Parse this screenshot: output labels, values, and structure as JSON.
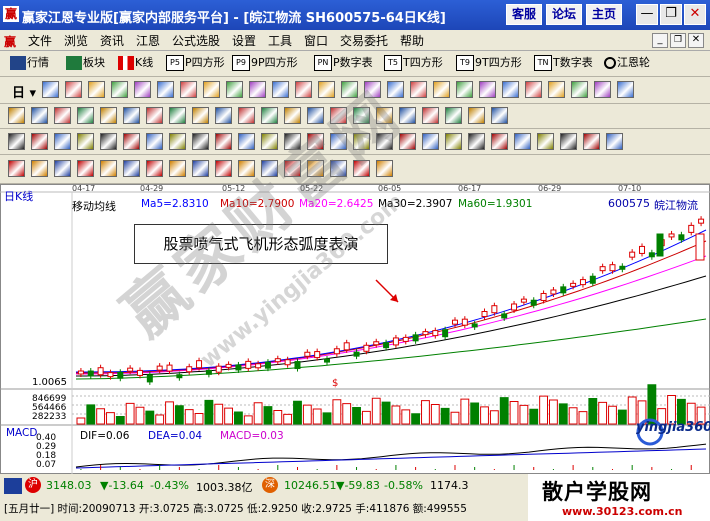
{
  "window": {
    "app_icon": "赢",
    "title": "赢家江恩专业版[赢家内部服务平台] - [皖江物流   SH600575-64日K线]",
    "buttons": [
      "客服",
      "论坛",
      "主页"
    ]
  },
  "menu": [
    "文件",
    "浏览",
    "资讯",
    "江恩",
    "公式选股",
    "设置",
    "工具",
    "窗口",
    "交易委托",
    "帮助"
  ],
  "toolbar1": [
    "行情",
    "板块",
    "K线",
    "P四方形",
    "9P四方形",
    "P数字表",
    "T四方形",
    "9T四方形",
    "T数字表",
    "江恩轮"
  ],
  "toolbar2_period": "日",
  "chart": {
    "period_label": "日K线",
    "date_ticks": [
      "04-17",
      "04-29",
      "05-12",
      "05-22",
      "06-05",
      "06-17",
      "06-29",
      "07-10"
    ],
    "ma_title": "移动均线",
    "ma": [
      {
        "label": "Ma5=2.8310",
        "color": "#0000ff"
      },
      {
        "label": "Ma10=2.7900",
        "color": "#cc0000"
      },
      {
        "label": "Ma20=2.6425",
        "color": "#ff00ff"
      },
      {
        "label": "Ma30=2.3907",
        "color": "#000000"
      },
      {
        "label": "Ma60=1.9301",
        "color": "#008000"
      }
    ],
    "stock_code": "600575",
    "stock_name": "皖江物流",
    "annotation": "股票喷气式飞机形态弧度表演",
    "price_low_label": "1.0065",
    "volume_labels": [
      "846699",
      "564466",
      "282233"
    ],
    "macd_title": "MACD",
    "dif": "DIF=0.06",
    "dea": "DEA=0.04",
    "macd": "MACD=0.03",
    "macd_ticks": [
      "0.40",
      "0.29",
      "0.18",
      "0.07"
    ],
    "watermark_text": "赢家财富网",
    "watermark_url": "www.yingjia360.com",
    "logo_text": "yingjia360",
    "chart_data": {
      "type": "candlestick",
      "ma_values": {
        "Ma5": 2.831,
        "Ma10": 2.79,
        "Ma20": 2.6425,
        "Ma30": 2.3907,
        "Ma60": 1.9301
      },
      "dates": [
        "04-17",
        "04-29",
        "05-12",
        "05-22",
        "06-05",
        "06-17",
        "06-29",
        "07-10"
      ],
      "last_close": 2.9725
    }
  },
  "status": {
    "sh_index": "3148.03",
    "sh_change": "▼-13.64",
    "sh_pct": "-0.43%",
    "sh_amount": "1003.38亿",
    "sz_index": "10246.51",
    "sz_change": "▼-59.83",
    "sz_pct": "-0.58%",
    "sz_amount": "1174.3",
    "row2": "[五月廿一] 时间:20090713 开:3.0725  高:3.0725  低:2.9250  收:2.9725  手:411876  额:499555"
  },
  "site_logo": {
    "name": "散户学股网",
    "url": "www.30123.com.cn"
  }
}
